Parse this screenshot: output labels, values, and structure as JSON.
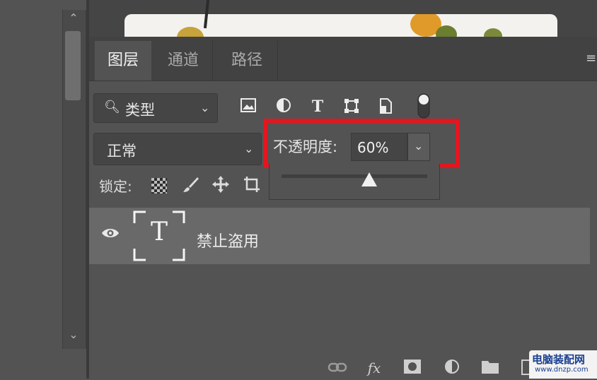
{
  "tabs": [
    {
      "label": "图层",
      "active": true
    },
    {
      "label": "通道",
      "active": false
    },
    {
      "label": "路径",
      "active": false
    }
  ],
  "filter": {
    "kind_label": "类型",
    "icons": [
      "image-filter-icon",
      "adjustment-filter-icon",
      "type-filter-icon",
      "shape-filter-icon",
      "smart-object-filter-icon"
    ]
  },
  "blend": {
    "mode": "正常"
  },
  "opacity": {
    "label": "不透明度:",
    "value": "60%",
    "level": 0.6
  },
  "lock": {
    "label": "锁定:"
  },
  "layer": {
    "name": "禁止盗用",
    "type": "T"
  },
  "highlight_color": "#e3161f",
  "watermark": {
    "title": "电脑装配网",
    "url": "www.dnzp.com"
  }
}
